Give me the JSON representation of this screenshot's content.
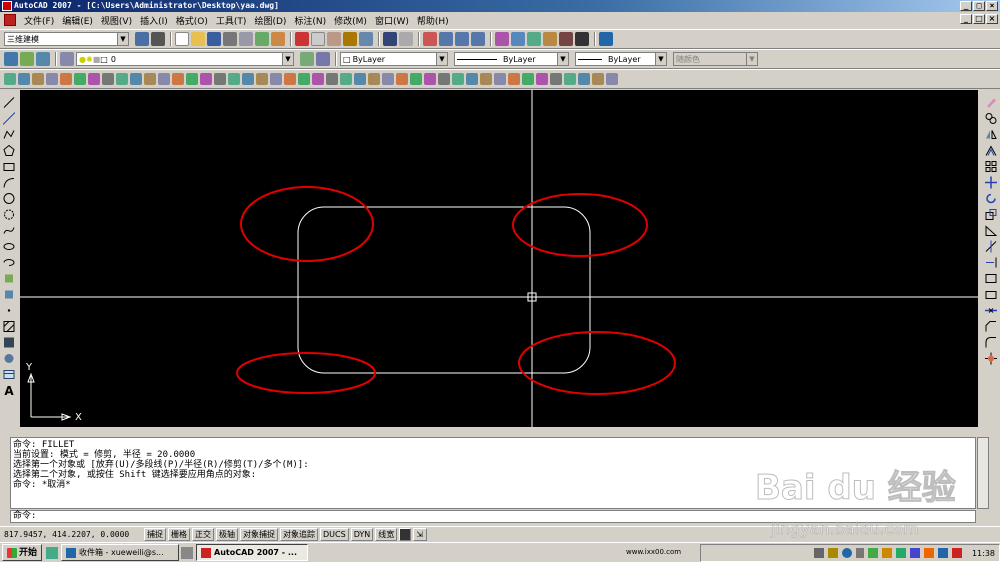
{
  "title": "AutoCAD 2007 - [C:\\Users\\Administrator\\Desktop\\yaa.dwg]",
  "menu": [
    "文件(F)",
    "编辑(E)",
    "视图(V)",
    "插入(I)",
    "格式(O)",
    "工具(T)",
    "绘图(D)",
    "标注(N)",
    "修改(M)",
    "窗口(W)",
    "帮助(H)"
  ],
  "workspace": "三维建模",
  "layer": "0",
  "color": "ByLayer",
  "linetype": "ByLayer",
  "lineweight": "ByLayer",
  "plotstyle": "随颜色",
  "axis": {
    "y": "Y",
    "x": "X"
  },
  "command_lines": [
    "命令:  FILLET",
    "当前设置: 模式 = 修剪, 半径 = 20.0000",
    "选择第一个对象或 [放弃(U)/多段线(P)/半径(R)/修剪(T)/多个(M)]:",
    "选择第二个对象, 或按住 Shift 键选择要应用角点的对象:",
    "命令: *取消*"
  ],
  "command_prompt": "命令:",
  "coords": "817.9457, 414.2207, 0.0000",
  "status_buttons": [
    "捕捉",
    "栅格",
    "正交",
    "极轴",
    "对象捕捉",
    "对象追踪",
    "DUCS",
    "DYN",
    "线宽"
  ],
  "taskbar": {
    "start": "开始",
    "tasks": [
      "收件箱 - xueweili@s...",
      "AutoCAD 2007 - ..."
    ],
    "url": "www.ixx00.com",
    "time": "11:38"
  },
  "watermark": {
    "brand": "Bai du 经验",
    "url": "jingyan.baidu.com"
  },
  "colors": {
    "canvas": "#000000",
    "highlight": "#e00000",
    "geometry": "#ffffff"
  }
}
